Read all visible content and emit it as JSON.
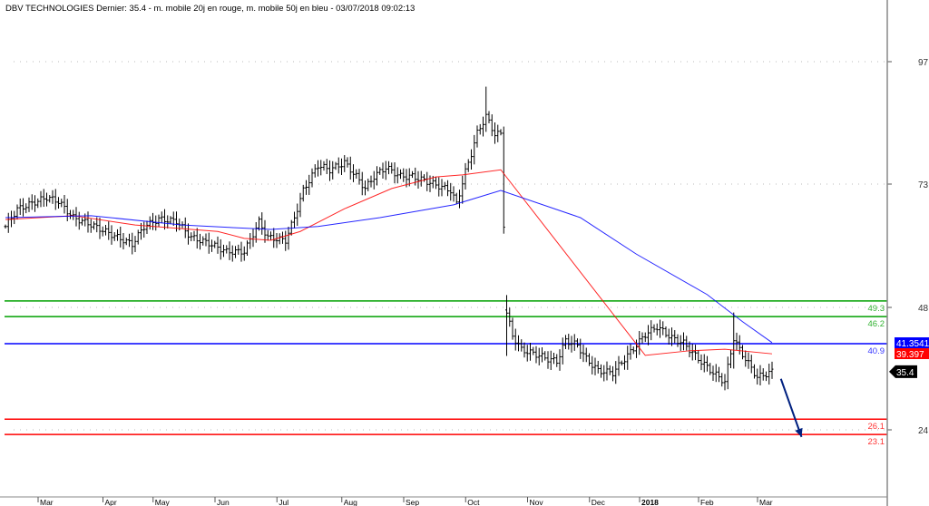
{
  "chart_data": {
    "type": "ohlc",
    "title": "DBV TECHNOLOGIES Dernier: 35.4 - m. mobile 20j en rouge, m. mobile 50j en bleu - 03/07/2018 09:02:13",
    "y_ticks": [
      24,
      48,
      73,
      97
    ],
    "y_tick_labels": [
      "24",
      "48",
      "73",
      "97"
    ],
    "x_ticks": [
      {
        "t": 12,
        "label": "Mar"
      },
      {
        "t": 34,
        "label": "Apr"
      },
      {
        "t": 51,
        "label": "May"
      },
      {
        "t": 72,
        "label": "Jun"
      },
      {
        "t": 93,
        "label": "Jul"
      },
      {
        "t": 115,
        "label": "Aug"
      },
      {
        "t": 136,
        "label": "Sep"
      },
      {
        "t": 157,
        "label": "Oct"
      },
      {
        "t": 178,
        "label": "Nov"
      },
      {
        "t": 199,
        "label": "Dec"
      },
      {
        "t": 216,
        "label": "2018"
      },
      {
        "t": 236,
        "label": "Feb"
      },
      {
        "t": 256,
        "label": "Mar"
      }
    ],
    "x_unit": "trading day index",
    "close_keypoints": [
      [
        0,
        64.4
      ],
      [
        4,
        67.9
      ],
      [
        14,
        70.3
      ],
      [
        18,
        69.5
      ],
      [
        23,
        66.2
      ],
      [
        29,
        64.8
      ],
      [
        38,
        62.2
      ],
      [
        43,
        60.8
      ],
      [
        47,
        64.4
      ],
      [
        52,
        65.9
      ],
      [
        58,
        65.5
      ],
      [
        63,
        62.2
      ],
      [
        69,
        61.0
      ],
      [
        75,
        59.3
      ],
      [
        81,
        59.3
      ],
      [
        86,
        65.3
      ],
      [
        89,
        62.2
      ],
      [
        95,
        61.6
      ],
      [
        98,
        66.2
      ],
      [
        101,
        71.7
      ],
      [
        106,
        76.7
      ],
      [
        110,
        75.8
      ],
      [
        115,
        77.2
      ],
      [
        119,
        74.5
      ],
      [
        122,
        72.1
      ],
      [
        125,
        74.5
      ],
      [
        129,
        76.3
      ],
      [
        134,
        74.5
      ],
      [
        138,
        74.5
      ],
      [
        143,
        73.5
      ],
      [
        147,
        72.6
      ],
      [
        151,
        71.7
      ],
      [
        153,
        69.0
      ],
      [
        156,
        75.4
      ],
      [
        158,
        79.0
      ],
      [
        160,
        83.0
      ],
      [
        163,
        86.3
      ],
      [
        166,
        82.8
      ],
      [
        168,
        82.8
      ],
      [
        170,
        46.9
      ],
      [
        172,
        42.5
      ],
      [
        175,
        39.7
      ],
      [
        180,
        38.8
      ],
      [
        184,
        37.9
      ],
      [
        187,
        37.4
      ],
      [
        190,
        41.5
      ],
      [
        194,
        40.6
      ],
      [
        197,
        37.9
      ],
      [
        201,
        35.6
      ],
      [
        206,
        35.2
      ],
      [
        210,
        37.9
      ],
      [
        214,
        40.6
      ],
      [
        217,
        42.7
      ],
      [
        221,
        44.2
      ],
      [
        226,
        42.0
      ],
      [
        230,
        41.0
      ],
      [
        235,
        37.9
      ],
      [
        240,
        35.2
      ],
      [
        244,
        33.4
      ],
      [
        247,
        42.0
      ],
      [
        249,
        39.7
      ],
      [
        252,
        37.0
      ],
      [
        255,
        34.3
      ],
      [
        260,
        35.4
      ]
    ],
    "series": [
      {
        "name": "m. mobile 20j",
        "color": "#ff0000",
        "points": [
          [
            0,
            65.8
          ],
          [
            23,
            66.6
          ],
          [
            44,
            64.7
          ],
          [
            72,
            63.4
          ],
          [
            81,
            62.0
          ],
          [
            90,
            61.6
          ],
          [
            100,
            63.4
          ],
          [
            115,
            68.0
          ],
          [
            131,
            72.1
          ],
          [
            146,
            74.4
          ],
          [
            155,
            74.8
          ],
          [
            168,
            75.8
          ],
          [
            217,
            38.6
          ],
          [
            232,
            39.5
          ],
          [
            244,
            39.8
          ],
          [
            260,
            38.9
          ]
        ]
      },
      {
        "name": "m. mobile 50j",
        "color": "#0000ff",
        "points": [
          [
            0,
            66.2
          ],
          [
            29,
            66.6
          ],
          [
            60,
            64.7
          ],
          [
            90,
            63.8
          ],
          [
            106,
            64.4
          ],
          [
            127,
            66.2
          ],
          [
            152,
            68.8
          ],
          [
            168,
            71.7
          ],
          [
            195,
            66.2
          ],
          [
            214,
            58.8
          ],
          [
            238,
            50.6
          ],
          [
            250,
            45.2
          ],
          [
            260,
            41.1
          ]
        ]
      }
    ],
    "levels": [
      {
        "value": 49.3,
        "label": "49.3",
        "color": "#00a000"
      },
      {
        "value": 46.2,
        "label": "46.2",
        "color": "#00a000"
      },
      {
        "value": 40.9,
        "label": "40.9",
        "color": "#0000ff"
      },
      {
        "value": 26.1,
        "label": "26.1",
        "color": "#ff0000"
      },
      {
        "value": 23.1,
        "label": "23.1",
        "color": "#ff0000"
      }
    ],
    "badges": [
      {
        "value": 41.3541,
        "label": "41.3541",
        "bg": "#0000ff"
      },
      {
        "value": 39.397,
        "label": "39.397",
        "bg": "#ff0000"
      },
      {
        "value": 35.4,
        "label": "35.4",
        "bg": "#000000"
      }
    ],
    "arrow": {
      "from": [
        263,
        34.0
      ],
      "to": [
        270,
        22.6
      ],
      "color": "#002080"
    }
  }
}
